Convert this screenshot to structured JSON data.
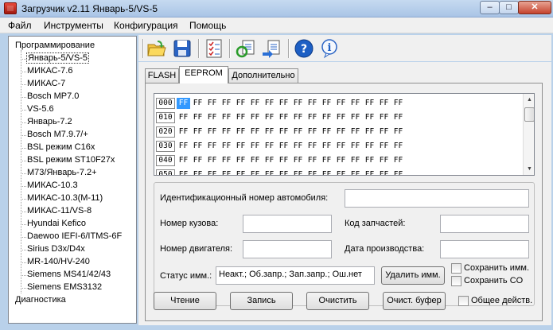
{
  "window": {
    "title": "Загрузчик v2.11 Январь-5/VS-5"
  },
  "menu": [
    "Файл",
    "Инструменты",
    "Конфигурация",
    "Помощь"
  ],
  "tree": {
    "root": "Программирование",
    "items": [
      "Январь-5/VS-5",
      "МИКАС-7.6",
      "МИКАС-7",
      "Bosch MP7.0",
      "VS-5.6",
      "Январь-7.2",
      "Bosch M7.9.7/+",
      "BSL режим C16x",
      "BSL режим ST10F27x",
      "M73/Январь-7.2+",
      "МИКАС-10.3",
      "МИКАС-10.3(M-11)",
      "МИКАС-11/VS-8",
      "Hyundai Kefico",
      "Daewoo IEFI-6/ITMS-6F",
      "Sirius D3x/D4x",
      "MR-140/HV-240",
      "Siemens MS41/42/43",
      "Siemens EMS3132"
    ],
    "selected": "Январь-5/VS-5",
    "root2": "Диагностика"
  },
  "toolbar": {
    "icons": [
      "open-folder-icon",
      "save-icon",
      "checklist-icon",
      "refresh-icon",
      "export-icon",
      "help-icon",
      "info-icon"
    ]
  },
  "tabs": [
    "FLASH",
    "EEPROM",
    "Дополнительно"
  ],
  "active_tab": "EEPROM",
  "hex": {
    "addresses": [
      "000",
      "010",
      "020",
      "030",
      "040",
      "050"
    ],
    "byte": "FF",
    "bytes_per_row": 16,
    "selected_cell": "000:0"
  },
  "fields": {
    "vin_label": "Идентификационный номер автомобиля:",
    "vin_value": "",
    "body_label": "Номер кузова:",
    "body_value": "",
    "part_label": "Код запчастей:",
    "part_value": "",
    "engine_label": "Номер двигателя:",
    "engine_value": "",
    "date_label": "Дата производства:",
    "date_value": "",
    "imm_label": "Статус имм.:",
    "imm_value": "Неакт.; Об.запр.; Зап.запр.; Ош.нет",
    "delete_imm": "Удалить имм.",
    "save_imm": "Сохранить имм.",
    "save_co": "Сохранить CO"
  },
  "actions": {
    "read": "Чтение",
    "write": "Запись",
    "clear": "Очистить",
    "clear_buffer": "Очист. буфер",
    "common_actions": "Общее действ."
  }
}
